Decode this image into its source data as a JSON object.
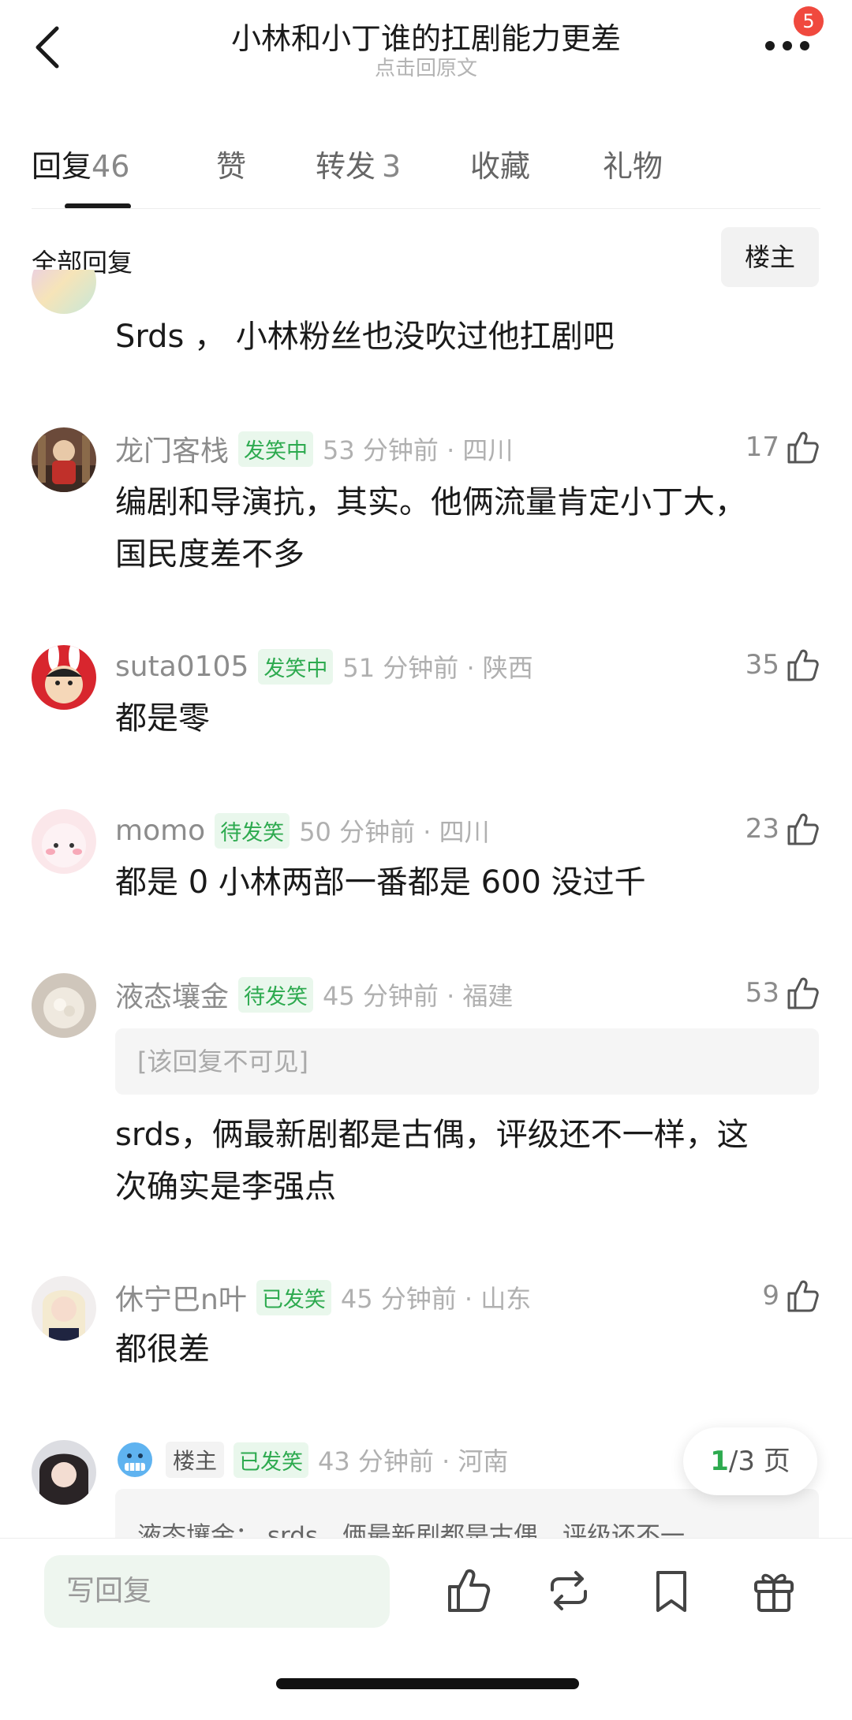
{
  "header": {
    "title": "小林和小丁谁的扛剧能力更差",
    "subtitle": "点击回原文",
    "notification_count": "5"
  },
  "tabs": [
    {
      "label": "回复",
      "count": "46",
      "active": true
    },
    {
      "label": "赞",
      "count": ""
    },
    {
      "label": "转发",
      "count": "3"
    },
    {
      "label": "收藏",
      "count": ""
    },
    {
      "label": "礼物",
      "count": ""
    }
  ],
  "section": {
    "label": "全部回复",
    "filter": "楼主"
  },
  "comments": [
    {
      "text": "Srds ， 小林粉丝也没吹过他扛剧吧"
    },
    {
      "username": "龙门客栈",
      "status": "发笑中",
      "time_loc": "53 分钟前 · 四川",
      "likes": "17",
      "text_lines": [
        "编剧和导演抗，其实。他俩流量肯定小丁大，",
        "国民度差不多"
      ]
    },
    {
      "username": "suta0105",
      "status": "发笑中",
      "time_loc": "51 分钟前 · 陕西",
      "likes": "35",
      "text_lines": [
        "都是零"
      ]
    },
    {
      "username": "momo",
      "status": "待发笑",
      "time_loc": "50 分钟前 · 四川",
      "likes": "23",
      "text_lines": [
        "都是 0 小林两部一番都是 600 没过千"
      ]
    },
    {
      "username": "液态壤金",
      "status": "待发笑",
      "time_loc": "45 分钟前 · 福建",
      "likes": "53",
      "hidden_reply": "[该回复不可见]",
      "text_lines": [
        "srds，俩最新剧都是古偶，评级还不一样，这",
        "次确实是李强点"
      ]
    },
    {
      "username": "休宁巴n叶",
      "status": "已发笑",
      "time_loc": "45 分钟前 · 山东",
      "likes": "9",
      "text_lines": [
        "都很差"
      ]
    },
    {
      "owner_tag": "楼主",
      "status": "已发笑",
      "time_loc": "43 分钟前 · 河南",
      "quote": "液态壤金： srds，俩最新剧都是古偶，评级还不一"
    }
  ],
  "pagination": {
    "current": "1",
    "total": "/3 页"
  },
  "bottom": {
    "reply_placeholder": "写回复"
  },
  "icons": [
    "back-icon",
    "more-icon",
    "like-icon",
    "repost-icon",
    "bookmark-icon",
    "gift-icon"
  ],
  "colors": {
    "accent_green": "#2daa4f",
    "badge_red": "#f0493e"
  }
}
